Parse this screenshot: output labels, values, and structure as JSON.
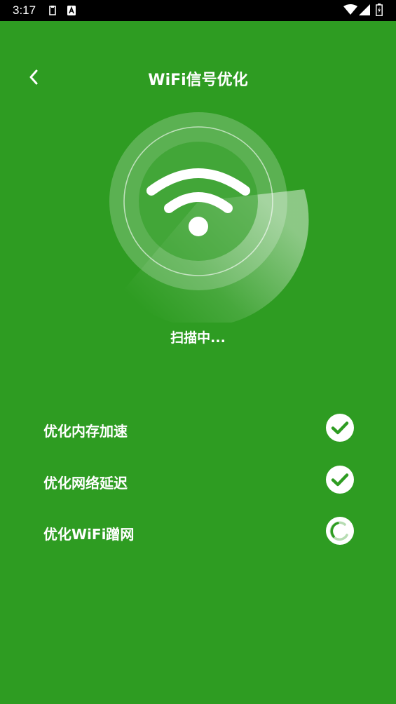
{
  "status_bar": {
    "time": "3:17",
    "left_icons": [
      "clipboard-icon",
      "font-a-icon"
    ],
    "right_icons": [
      "wifi-signal-icon",
      "cell-signal-icon",
      "battery-icon"
    ]
  },
  "header": {
    "back_icon": "chevron-left-icon",
    "title": "WiFi信号优化"
  },
  "scanner": {
    "icon": "wifi-icon",
    "status_text": "扫描中..."
  },
  "tasks": [
    {
      "label": "优化内存加速",
      "state": "done",
      "icon": "check-circle-icon"
    },
    {
      "label": "优化网络延迟",
      "state": "done",
      "icon": "check-circle-icon"
    },
    {
      "label": "优化WiFi蹭网",
      "state": "in-progress",
      "icon": "spinner-icon"
    }
  ],
  "colors": {
    "background": "#2e9c22",
    "text": "#ffffff",
    "check": "#2e9c22"
  }
}
